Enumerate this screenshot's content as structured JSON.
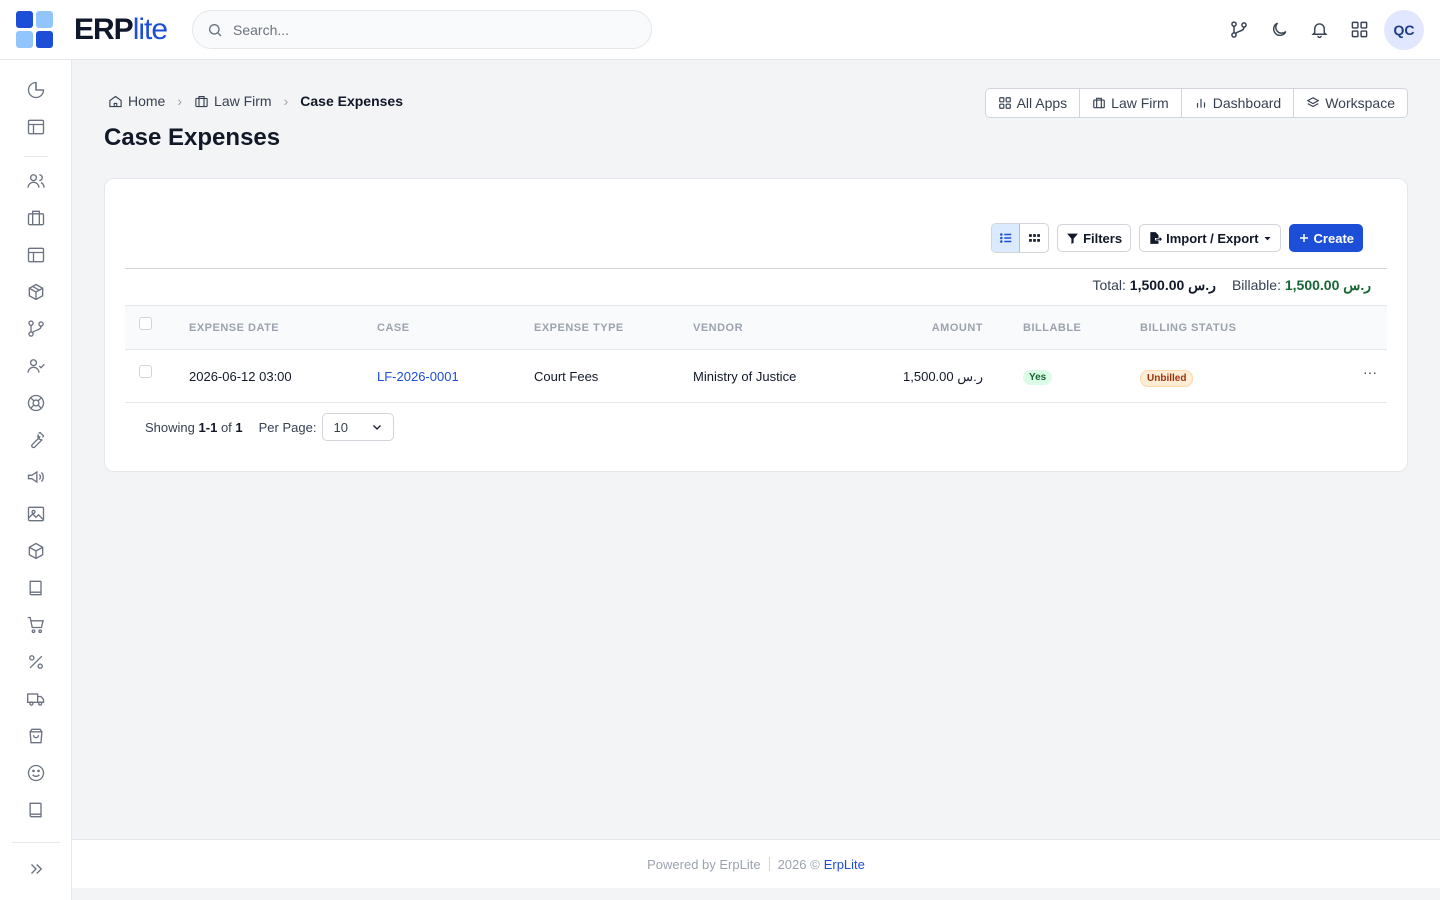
{
  "app": {
    "logo_bold": "ERP",
    "logo_light": "lite",
    "colors": {
      "blue_dark": "#1d4ed8",
      "blue_light": "#93c5fd"
    }
  },
  "search": {
    "placeholder": "Search..."
  },
  "topbar": {
    "icons": [
      "git-branch-icon",
      "moon-icon",
      "bell-icon",
      "apps-grid-icon"
    ],
    "avatar_initials": "QC"
  },
  "sidebar": {
    "icons": [
      "pie-chart-icon",
      "layout-icon",
      "users-icon",
      "briefcase-icon",
      "table-icon",
      "box-icon",
      "git-branch-icon",
      "user-check-icon",
      "support-icon",
      "wrench-icon",
      "megaphone-icon",
      "image-icon",
      "package-icon",
      "book-icon",
      "cart-icon",
      "percent-icon",
      "truck-icon",
      "shopping-bag-icon",
      "smile-icon",
      "book-open-icon"
    ],
    "expand_icon": "chevrons-right-icon"
  },
  "breadcrumb": {
    "home": "Home",
    "module": "Law Firm",
    "current": "Case Expenses"
  },
  "page_title": "Case Expenses",
  "apps_nav": {
    "all_apps": "All Apps",
    "law_firm": "Law Firm",
    "dashboard": "Dashboard",
    "workspace": "Workspace"
  },
  "toolbar": {
    "filters": "Filters",
    "import_export": "Import / Export",
    "create": "Create"
  },
  "totals": {
    "total_label": "Total:",
    "total_value": "ر.س 1,500.00",
    "billable_label": "Billable:",
    "billable_value": "ر.س 1,500.00"
  },
  "table": {
    "columns": [
      "EXPENSE DATE",
      "CASE",
      "EXPENSE TYPE",
      "VENDOR",
      "AMOUNT",
      "BILLABLE",
      "BILLING STATUS"
    ],
    "rows": [
      {
        "expense_date": "2026-06-12 03:00",
        "case": "LF-2026-0001",
        "expense_type": "Court Fees",
        "vendor": "Ministry of Justice",
        "amount": "ر.س 1,500.00",
        "billable": "Yes",
        "billing_status": "Unbilled",
        "menu": "···"
      }
    ]
  },
  "pagination": {
    "showing_label": "Showing",
    "range_start": "1",
    "range_sep": "-",
    "range_end": "1",
    "of_label": "of",
    "total": "1",
    "per_page_label": "Per Page:",
    "per_page_value": "10"
  },
  "footer": {
    "powered_by": "Powered by ErpLite",
    "year": "2026 ©",
    "brand": "ErpLite"
  }
}
